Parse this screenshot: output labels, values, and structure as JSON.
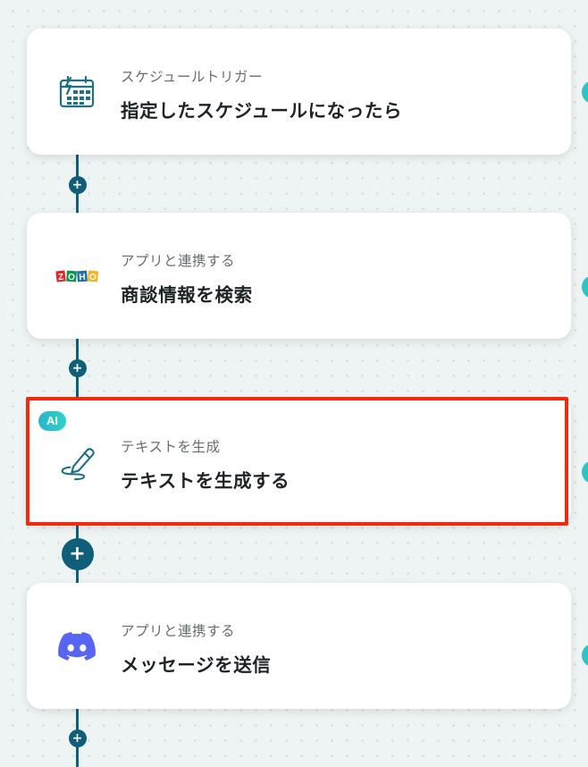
{
  "flow": {
    "steps": [
      {
        "subtitle": "スケジュールトリガー",
        "title": "指定したスケジュールになったら",
        "icon": "schedule-calendar-icon"
      },
      {
        "subtitle": "アプリと連携する",
        "title": "商談情報を検索",
        "icon": "zoho-logo-icon",
        "logo_text": [
          "Z",
          "O",
          "H",
          "O"
        ]
      },
      {
        "subtitle": "テキストを生成",
        "title": "テキストを生成する",
        "icon": "pen-scribble-icon",
        "badge": "AI",
        "selected": true
      },
      {
        "subtitle": "アプリと連携する",
        "title": "メッセージを送信",
        "icon": "discord-logo-icon"
      }
    ],
    "add_symbol": "+"
  },
  "colors": {
    "line": "#0f5f7a",
    "highlight": "#f3280c",
    "ai_badge": "#27b6cf",
    "discord": "#5865f2",
    "edge_dot": "#2fc4c4"
  }
}
